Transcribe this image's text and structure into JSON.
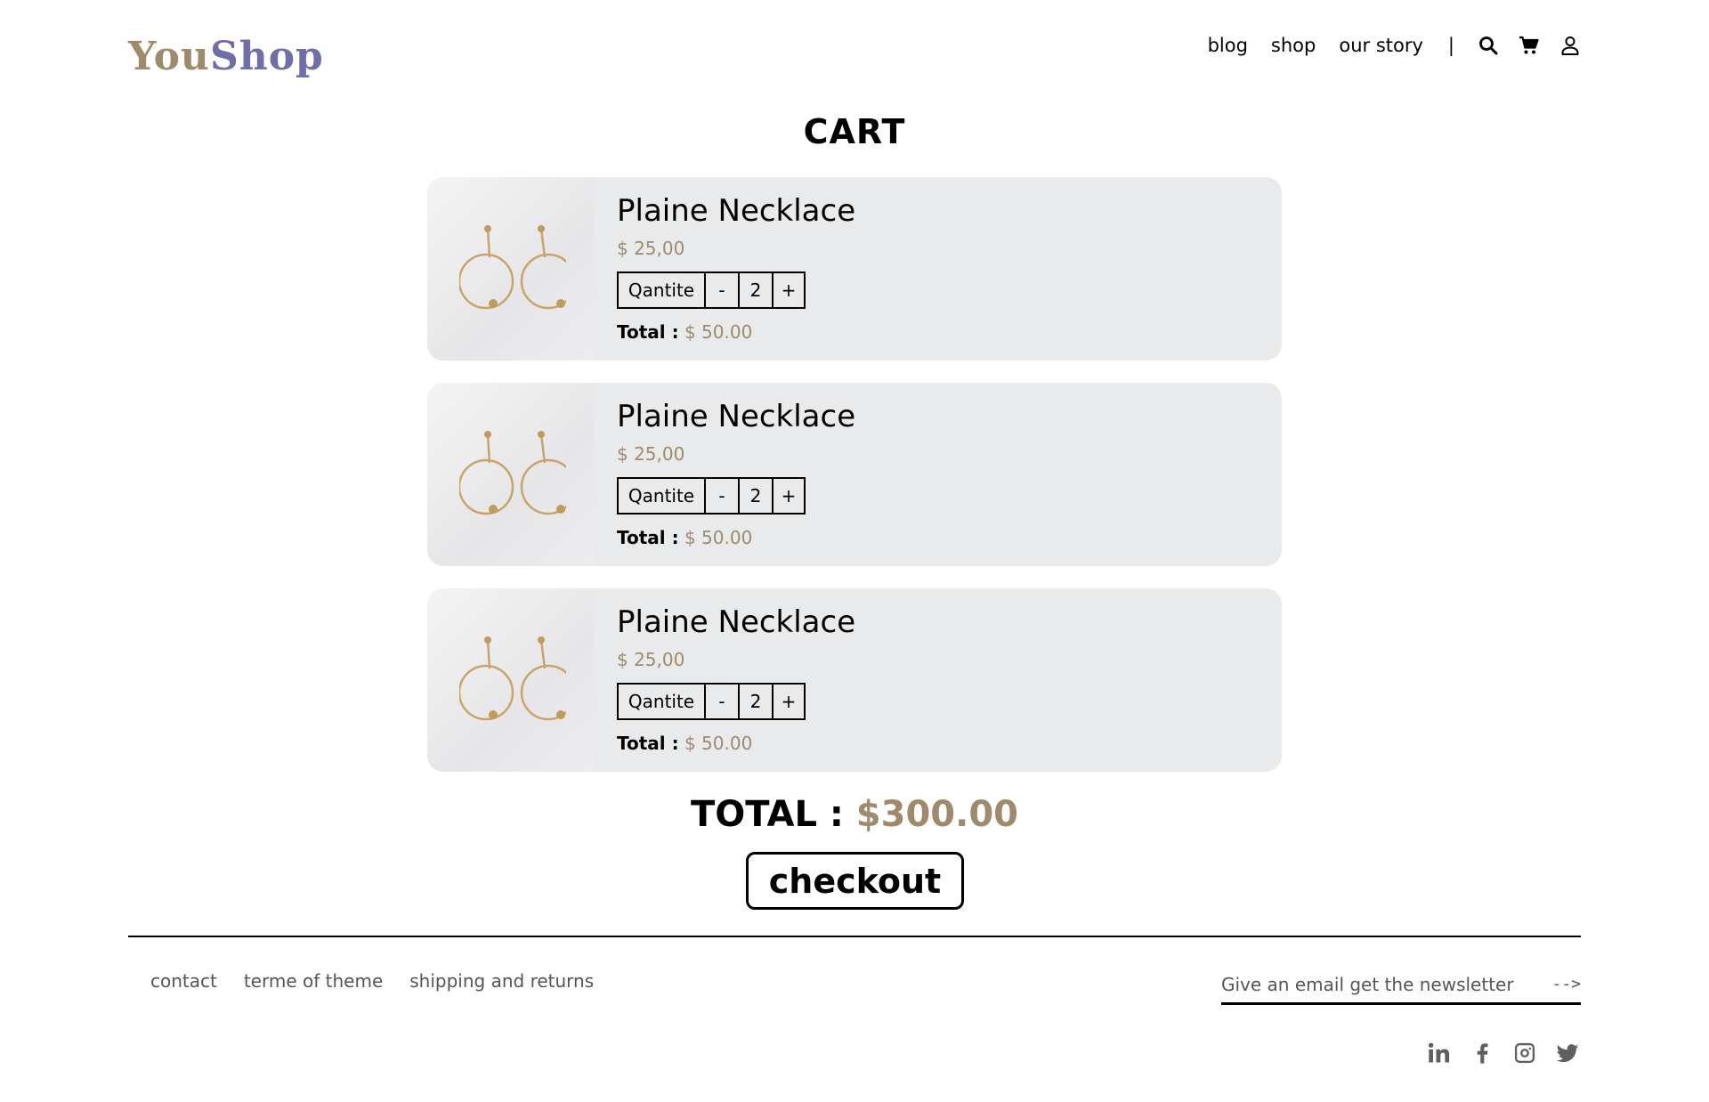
{
  "header": {
    "logo_part1": "You",
    "logo_part2": "Shop",
    "nav": [
      "blog",
      "shop",
      "our story"
    ],
    "separator": "|",
    "icons": [
      "search-icon",
      "cart-icon",
      "user-icon"
    ]
  },
  "title": "CART",
  "items": [
    {
      "name": "Plaine Necklace",
      "price": "$ 25,00",
      "qty_label": "Qantite",
      "minus": "-",
      "qty": "2",
      "plus": "+",
      "total_label": "Total :",
      "total": "$ 50.00"
    },
    {
      "name": "Plaine Necklace",
      "price": "$ 25,00",
      "qty_label": "Qantite",
      "minus": "-",
      "qty": "2",
      "plus": "+",
      "total_label": "Total :",
      "total": "$ 50.00"
    },
    {
      "name": "Plaine Necklace",
      "price": "$ 25,00",
      "qty_label": "Qantite",
      "minus": "-",
      "qty": "2",
      "plus": "+",
      "total_label": "Total :",
      "total": "$ 50.00"
    }
  ],
  "grand_total": {
    "label": "TOTAL :",
    "value": "$300.00"
  },
  "checkout_label": "checkout",
  "footer": {
    "links": [
      "contact",
      "terme of theme",
      "shipping and returns"
    ],
    "newsletter_placeholder": "Give an email get the newsletter",
    "newsletter_arrow": "-->",
    "social": [
      "linkedin-icon",
      "facebook-icon",
      "instagram-icon",
      "twitter-icon"
    ]
  },
  "colors": {
    "accent": "#a08a6c",
    "logo_secondary": "#6f6ea8",
    "card_bg": "#e9eaeb"
  }
}
